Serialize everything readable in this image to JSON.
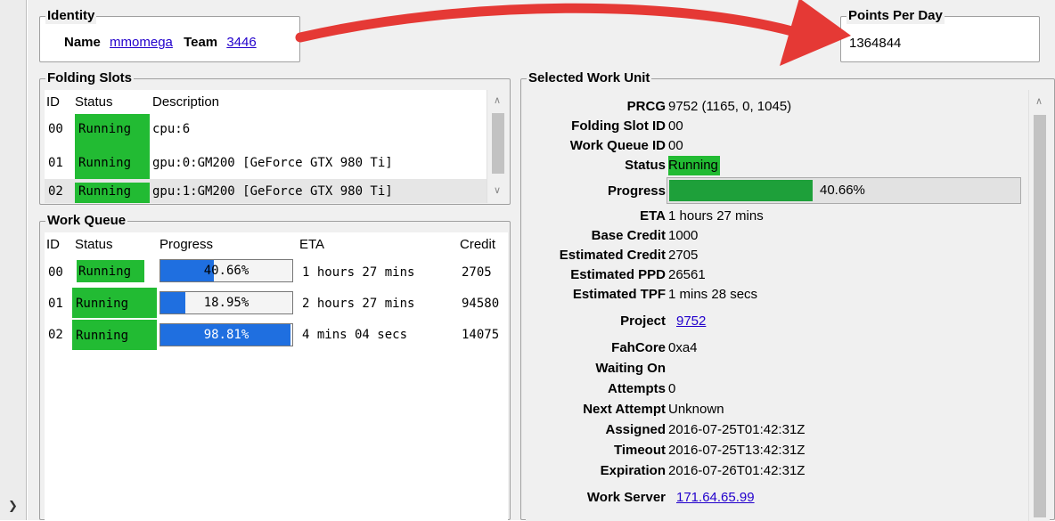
{
  "identity": {
    "title": "Identity",
    "name_label": "Name",
    "name_value": "mmomega",
    "team_label": "Team",
    "team_value": "3446"
  },
  "ppd": {
    "title": "Points Per Day",
    "value": "1364844"
  },
  "slots": {
    "title": "Folding Slots",
    "columns": [
      "ID",
      "Status",
      "Description"
    ],
    "rows": [
      {
        "id": "00",
        "status": "Running",
        "desc": "cpu:6"
      },
      {
        "id": "01",
        "status": "Running",
        "desc": "gpu:0:GM200 [GeForce GTX 980 Ti]"
      },
      {
        "id": "02",
        "status": "Running",
        "desc": "gpu:1:GM200 [GeForce GTX 980 Ti]"
      }
    ]
  },
  "queue": {
    "title": "Work Queue",
    "columns": [
      "ID",
      "Status",
      "Progress",
      "ETA",
      "Credit"
    ],
    "rows": [
      {
        "id": "00",
        "status": "Running",
        "progress": "40.66%",
        "progress_frac": 0.4066,
        "eta": "1 hours 27 mins",
        "credit": "2705"
      },
      {
        "id": "01",
        "status": "Running",
        "progress": "18.95%",
        "progress_frac": 0.1895,
        "eta": "2 hours 27 mins",
        "credit": "94580"
      },
      {
        "id": "02",
        "status": "Running",
        "progress": "98.81%",
        "progress_frac": 0.9881,
        "eta": "4 mins 04 secs",
        "credit": "14075"
      }
    ]
  },
  "wu": {
    "title": "Selected Work Unit",
    "prcg_label": "PRCG",
    "prcg": "9752 (1165, 0, 1045)",
    "slot_label": "Folding Slot ID",
    "slot": "00",
    "queue_label": "Work Queue ID",
    "queue": "00",
    "status_label": "Status",
    "status": "Running",
    "progress_label": "Progress",
    "progress": "40.66%",
    "progress_frac": 0.4066,
    "eta_label": "ETA",
    "eta": "1 hours 27 mins",
    "base_credit_label": "Base Credit",
    "base_credit": "1000",
    "est_credit_label": "Estimated Credit",
    "est_credit": "2705",
    "est_ppd_label": "Estimated PPD",
    "est_ppd": "26561",
    "est_tpf_label": "Estimated TPF",
    "est_tpf": "1 mins 28 secs",
    "project_label": "Project",
    "project": "9752",
    "fahcore_label": "FahCore",
    "fahcore": "0xa4",
    "waiting_label": "Waiting On",
    "waiting": "",
    "attempts_label": "Attempts",
    "attempts": "0",
    "next_attempt_label": "Next Attempt",
    "next_attempt": "Unknown",
    "assigned_label": "Assigned",
    "assigned": "2016-07-25T01:42:31Z",
    "timeout_label": "Timeout",
    "timeout": "2016-07-25T13:42:31Z",
    "expiration_label": "Expiration",
    "expiration": "2016-07-26T01:42:31Z",
    "server_label": "Work Server",
    "server": "171.64.65.99"
  },
  "colors": {
    "running": "#22bb33",
    "progress_blue": "#1f6fe0",
    "progress_green": "#1ea03a",
    "arrow": "#e53935",
    "link": "#2200cc"
  },
  "icons": {
    "collapse": "chevron-right-icon",
    "scroll_up": "scroll-up-icon",
    "scroll_down": "scroll-down-icon"
  }
}
